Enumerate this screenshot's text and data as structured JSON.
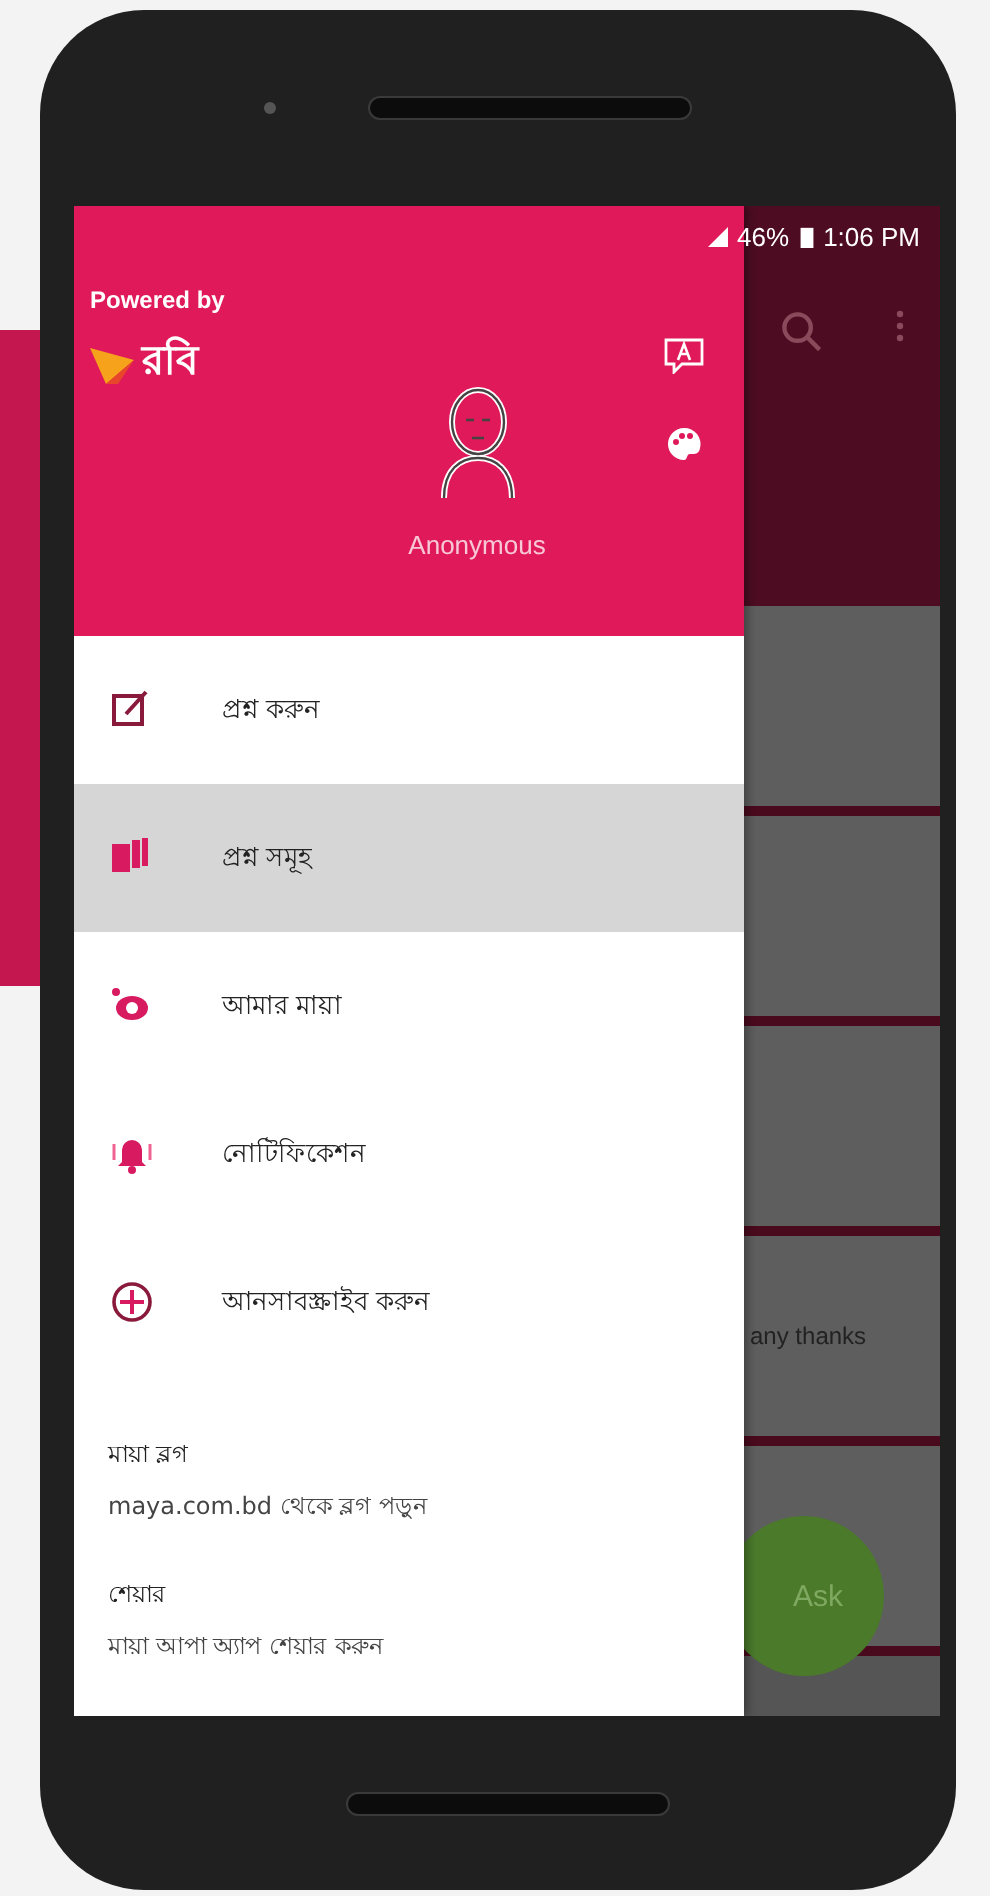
{
  "status_bar": {
    "battery": "46%",
    "time": "1:06 PM"
  },
  "drawer": {
    "powered_by": "Powered by",
    "brand": "রবি",
    "user_name": "Anonymous",
    "items": [
      {
        "label": "প্রশ্ন করুন",
        "selected": false
      },
      {
        "label": "প্রশ্ন সমূহ",
        "selected": true
      },
      {
        "label": "আমার মায়া",
        "selected": false
      },
      {
        "label": "নোটিফিকেশন",
        "selected": false
      },
      {
        "label": "আনসাবস্ক্রাইব করুন",
        "selected": false
      }
    ],
    "sections": [
      {
        "title": "মায়া ব্লগ",
        "subtitle": "maya.com.bd থেকে ব্লগ পড়ুন"
      },
      {
        "title": "শেয়ার",
        "subtitle": "মায়া আপা অ্যাপ শেয়ার করুন"
      }
    ]
  },
  "background": {
    "snippet": "any thanks",
    "fab": "Ask"
  }
}
